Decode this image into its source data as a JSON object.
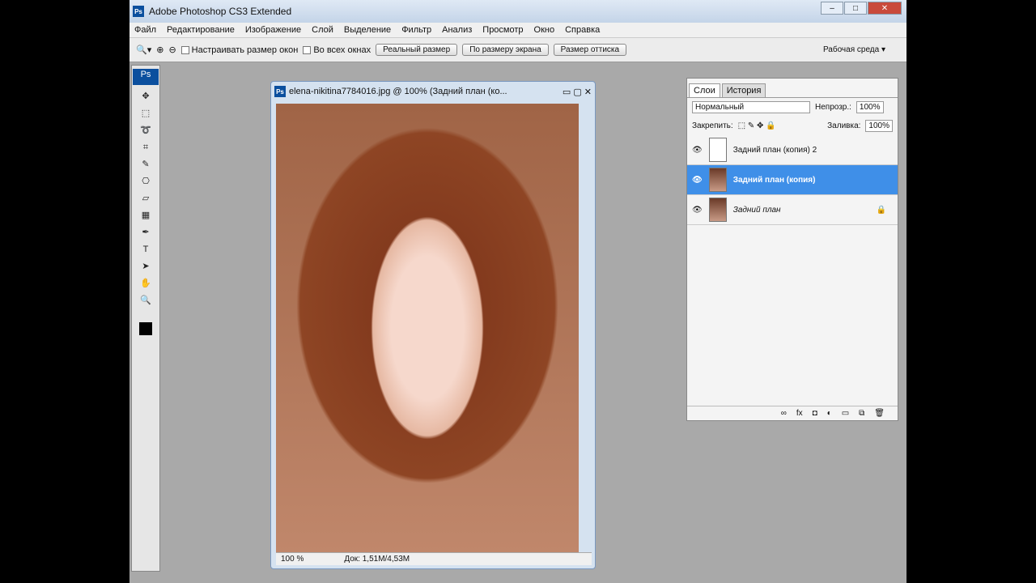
{
  "title": "Adobe Photoshop CS3 Extended",
  "menu": [
    "Файл",
    "Редактирование",
    "Изображение",
    "Слой",
    "Выделение",
    "Фильтр",
    "Анализ",
    "Просмотр",
    "Окно",
    "Справка"
  ],
  "options": {
    "resize": "Настраивать размер окон",
    "all": "Во всех окнах",
    "b1": "Реальный размер",
    "b2": "По размеру экрана",
    "b3": "Размер оттиска",
    "ws": "Рабочая среда"
  },
  "doc": {
    "title": "elena-nikitina7784016.jpg @ 100% (Задний план (ко...",
    "zoom": "100 %",
    "info": "Док: 1,51M/4,53M"
  },
  "panel": {
    "tab1": "Слои",
    "tab2": "История",
    "mode": "Нормальный",
    "op_l": "Непрозр.:",
    "op": "100%",
    "lock": "Закрепить:",
    "fill_l": "Заливка:",
    "fill": "100%",
    "layers": [
      "Задний план (копия) 2",
      "Задний план (копия)",
      "Задний план"
    ]
  }
}
